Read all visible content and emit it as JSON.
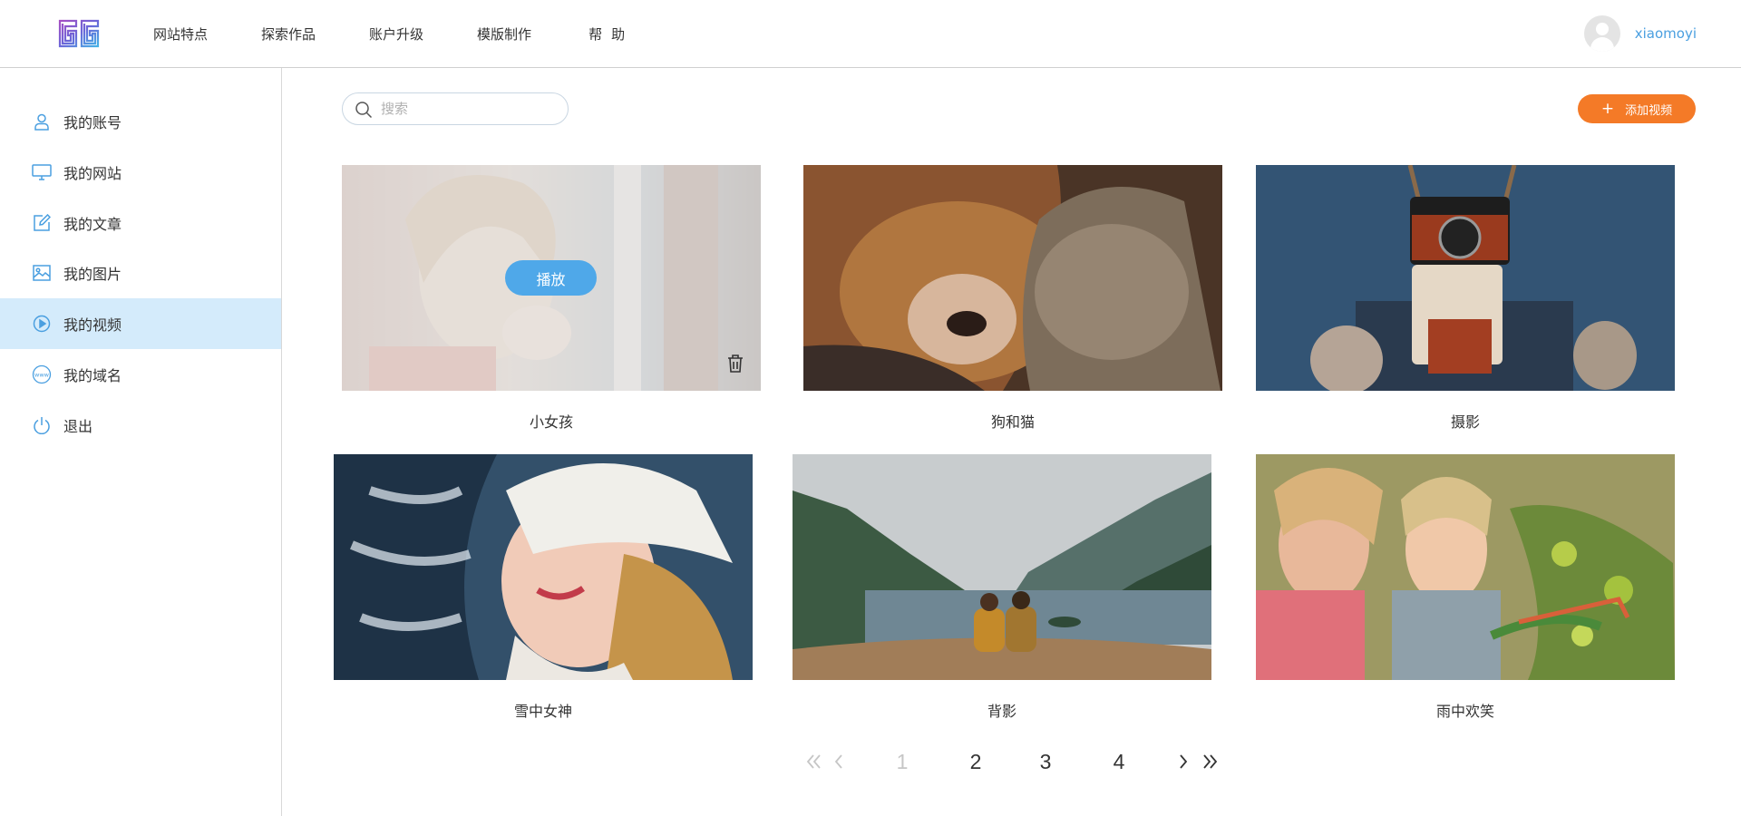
{
  "header": {
    "logo": "GG",
    "nav": [
      "网站特点",
      "探索作品",
      "账户升级",
      "模版制作",
      "帮助"
    ],
    "username": "xiaomoyi"
  },
  "sidebar": {
    "items": [
      {
        "label": "我的账号",
        "icon": "user-icon",
        "active": false
      },
      {
        "label": "我的网站",
        "icon": "monitor-icon",
        "active": false
      },
      {
        "label": "我的文章",
        "icon": "edit-icon",
        "active": false
      },
      {
        "label": "我的图片",
        "icon": "image-icon",
        "active": false
      },
      {
        "label": "我的视频",
        "icon": "play-circle-icon",
        "active": true
      },
      {
        "label": "我的域名",
        "icon": "www-icon",
        "active": false
      },
      {
        "label": "退出",
        "icon": "power-icon",
        "active": false
      }
    ]
  },
  "toolbar": {
    "search_placeholder": "搜索",
    "search_value": "",
    "add_label": "添加视频"
  },
  "videos": [
    {
      "title": "小女孩",
      "play_label": "播放"
    },
    {
      "title": "狗和猫"
    },
    {
      "title": "摄影"
    },
    {
      "title": "雪中女神"
    },
    {
      "title": "背影"
    },
    {
      "title": "雨中欢笑"
    }
  ],
  "pagination": {
    "pages": [
      "1",
      "2",
      "3",
      "4"
    ],
    "current": "1"
  },
  "colors": {
    "accent": "#4fa8e9",
    "active_bg": "#d4ebfb",
    "add_button": "#f47a27",
    "icon": "#4a9fe0"
  }
}
